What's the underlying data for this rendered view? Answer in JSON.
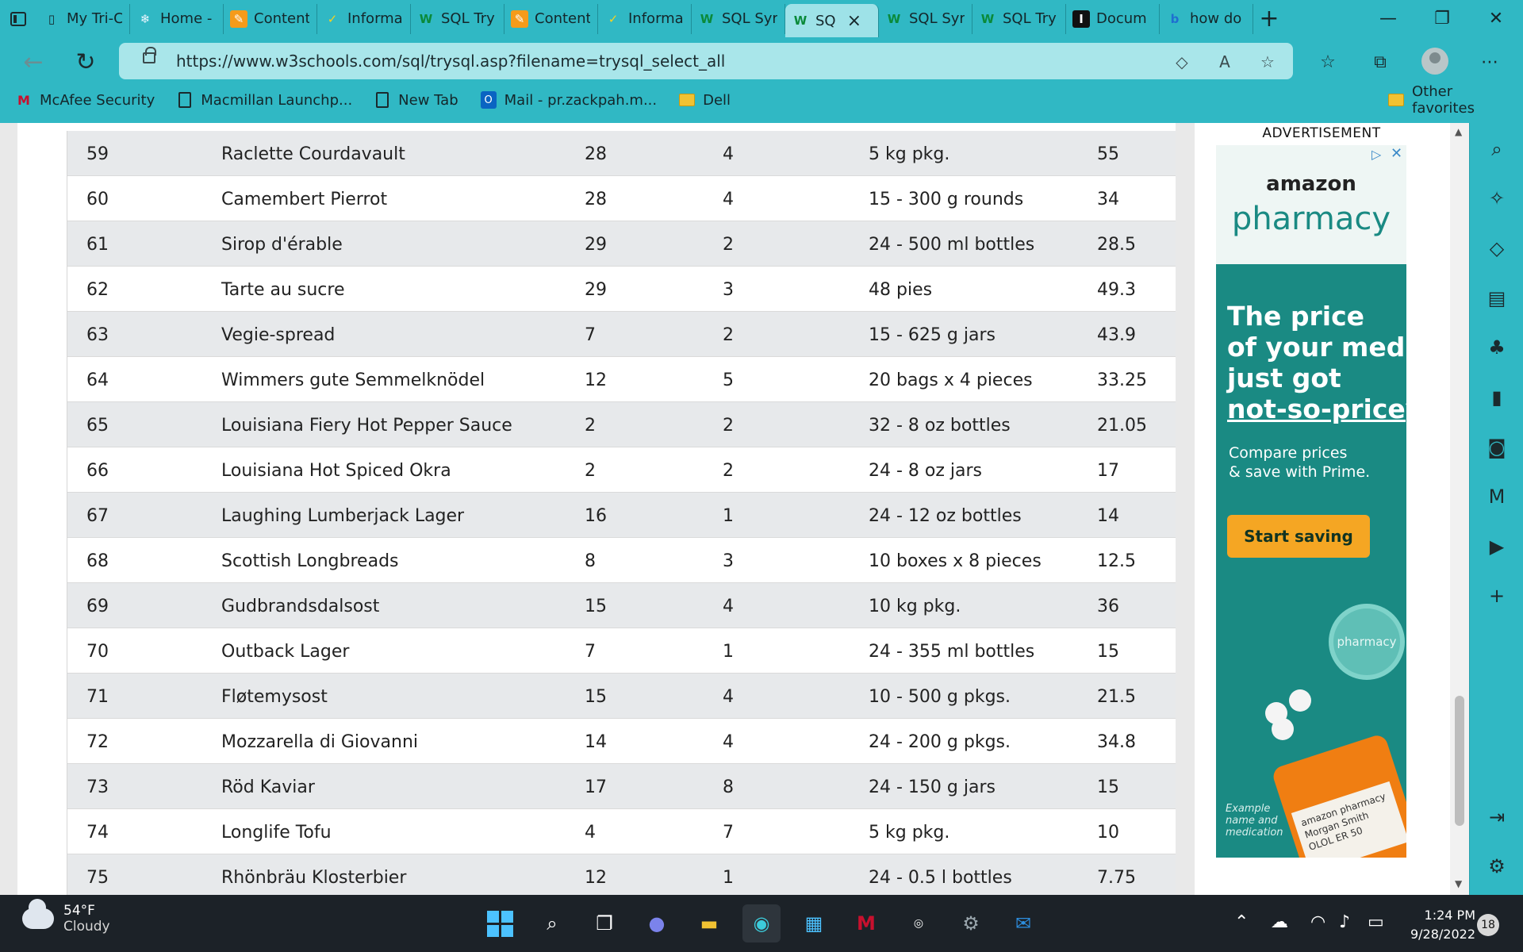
{
  "tabs": [
    {
      "label": "My Tri-C",
      "icon": "page-icon"
    },
    {
      "label": "Home -",
      "icon": "snowflake-icon"
    },
    {
      "label": "Content",
      "icon": "pencil-icon"
    },
    {
      "label": "Informa",
      "icon": "chart-icon"
    },
    {
      "label": "SQL Try",
      "icon": "w3-icon"
    },
    {
      "label": "Content",
      "icon": "pencil-icon"
    },
    {
      "label": "Informa",
      "icon": "chart-icon"
    },
    {
      "label": "SQL Syr",
      "icon": "w3-icon"
    },
    {
      "label": "SQ",
      "icon": "w3-icon",
      "active": true
    },
    {
      "label": "SQL Syr",
      "icon": "w3-icon"
    },
    {
      "label": "SQL Try",
      "icon": "w3-icon"
    },
    {
      "label": "Docum",
      "icon": "doc-icon"
    },
    {
      "label": "how do",
      "icon": "bing-icon"
    }
  ],
  "address": {
    "url": "https://www.w3schools.com/sql/trysql.asp?filename=trysql_select_all"
  },
  "favorites": [
    {
      "label": "McAfee Security",
      "icon": "mcafee-icon"
    },
    {
      "label": "Macmillan Launchp...",
      "icon": "page-icon"
    },
    {
      "label": "New Tab",
      "icon": "page-icon"
    },
    {
      "label": "Mail - pr.zackpah.m...",
      "icon": "outlook-icon"
    },
    {
      "label": "Dell",
      "icon": "folder-icon"
    }
  ],
  "other_favorites": "Other favorites",
  "rows": [
    {
      "id": "59",
      "name": "Raclette Courdavault",
      "supplier": "28",
      "category": "4",
      "unit": "5 kg pkg.",
      "price": "55"
    },
    {
      "id": "60",
      "name": "Camembert Pierrot",
      "supplier": "28",
      "category": "4",
      "unit": "15 - 300 g rounds",
      "price": "34"
    },
    {
      "id": "61",
      "name": "Sirop d'érable",
      "supplier": "29",
      "category": "2",
      "unit": "24 - 500 ml bottles",
      "price": "28.5"
    },
    {
      "id": "62",
      "name": "Tarte au sucre",
      "supplier": "29",
      "category": "3",
      "unit": "48 pies",
      "price": "49.3"
    },
    {
      "id": "63",
      "name": "Vegie-spread",
      "supplier": "7",
      "category": "2",
      "unit": "15 - 625 g jars",
      "price": "43.9"
    },
    {
      "id": "64",
      "name": "Wimmers gute Semmelknödel",
      "supplier": "12",
      "category": "5",
      "unit": "20 bags x 4 pieces",
      "price": "33.25"
    },
    {
      "id": "65",
      "name": "Louisiana Fiery Hot Pepper Sauce",
      "supplier": "2",
      "category": "2",
      "unit": "32 - 8 oz bottles",
      "price": "21.05"
    },
    {
      "id": "66",
      "name": "Louisiana Hot Spiced Okra",
      "supplier": "2",
      "category": "2",
      "unit": "24 - 8 oz jars",
      "price": "17"
    },
    {
      "id": "67",
      "name": "Laughing Lumberjack Lager",
      "supplier": "16",
      "category": "1",
      "unit": "24 - 12 oz bottles",
      "price": "14"
    },
    {
      "id": "68",
      "name": "Scottish Longbreads",
      "supplier": "8",
      "category": "3",
      "unit": "10 boxes x 8 pieces",
      "price": "12.5"
    },
    {
      "id": "69",
      "name": "Gudbrandsdalsost",
      "supplier": "15",
      "category": "4",
      "unit": "10 kg pkg.",
      "price": "36"
    },
    {
      "id": "70",
      "name": "Outback Lager",
      "supplier": "7",
      "category": "1",
      "unit": "24 - 355 ml bottles",
      "price": "15"
    },
    {
      "id": "71",
      "name": "Fløtemysost",
      "supplier": "15",
      "category": "4",
      "unit": "10 - 500 g pkgs.",
      "price": "21.5"
    },
    {
      "id": "72",
      "name": "Mozzarella di Giovanni",
      "supplier": "14",
      "category": "4",
      "unit": "24 - 200 g pkgs.",
      "price": "34.8"
    },
    {
      "id": "73",
      "name": "Röd Kaviar",
      "supplier": "17",
      "category": "8",
      "unit": "24 - 150 g jars",
      "price": "15"
    },
    {
      "id": "74",
      "name": "Longlife Tofu",
      "supplier": "4",
      "category": "7",
      "unit": "5 kg pkg.",
      "price": "10"
    },
    {
      "id": "75",
      "name": "Rhönbräu Klosterbier",
      "supplier": "12",
      "category": "1",
      "unit": "24 - 0.5 l bottles",
      "price": "7.75"
    }
  ],
  "ad": {
    "label": "ADVERTISEMENT",
    "brand": "amazon",
    "brand_line2": "pharmacy",
    "headline": [
      "The price",
      "of your meds",
      "just got",
      "not-so-pricey."
    ],
    "sub": [
      "Compare prices",
      "& save with Prime."
    ],
    "cta": "Start saving",
    "cap_text": "pharmacy",
    "caption": "Example name and medication",
    "bottle_label": "amazon pharmacy Morgan Smith OLOL ER 50",
    "accent": "#1a8a83",
    "button_color": "#f5a623"
  },
  "taskbar": {
    "temp": "54°F",
    "weather": "Cloudy",
    "time": "1:24 PM",
    "date": "9/28/2022",
    "notifications": "18"
  },
  "colors": {
    "browser_chrome": "#30b8c4",
    "row_shade": "#e7e9eb",
    "taskbar": "#1c2228"
  }
}
